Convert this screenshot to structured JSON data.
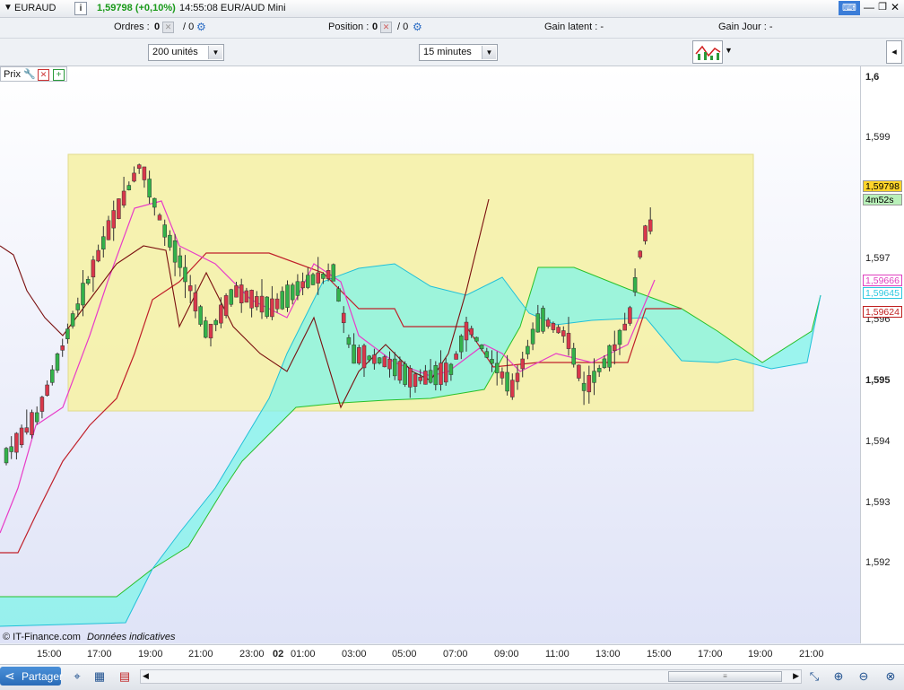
{
  "window": {
    "symbol": "EURAUD",
    "price_change": "1,59798 (+0,10%)",
    "time_title": "14:55:08 EUR/AUD Mini"
  },
  "infobar": {
    "orders_label": "Ordres :",
    "orders_value": "0",
    "orders_sep": "/ 0",
    "position_label": "Position :",
    "position_value": "0",
    "position_sep": "/ 0",
    "gain_latent": "Gain latent :  -",
    "gain_jour": "Gain Jour :  -"
  },
  "controls": {
    "units_select": "200 unités",
    "timeframe_select": "15 minutes"
  },
  "chart_header": {
    "label": "Prix"
  },
  "copyright": "© IT-Finance.com",
  "disclaimer": "Données indicatives",
  "price_axis": [
    {
      "label": "1,6",
      "bold": true
    },
    {
      "label": "1,599"
    },
    {
      "label": "1,597"
    },
    {
      "label": "1,596"
    },
    {
      "label": "1,595",
      "bold": true
    },
    {
      "label": "1,594"
    },
    {
      "label": "1,593"
    },
    {
      "label": "1,592"
    }
  ],
  "price_tags": [
    {
      "text": "1,59798",
      "bg": "#ffd42a",
      "fg": "#000"
    },
    {
      "text": "4m52s",
      "bg": "#b9f0b9",
      "fg": "#000"
    },
    {
      "text": "1,59666",
      "bg": "#ffffff",
      "fg": "#e040c0"
    },
    {
      "text": "1,59645",
      "bg": "#ffffff",
      "fg": "#2ec8e0"
    },
    {
      "text": "1,59624",
      "bg": "#ffffff",
      "fg": "#c02020"
    }
  ],
  "time_axis": [
    "15:00",
    "17:00",
    "19:00",
    "21:00",
    "23:00",
    "02",
    "01:00",
    "03:00",
    "05:00",
    "07:00",
    "09:00",
    "11:00",
    "13:00",
    "15:00",
    "17:00",
    "19:00",
    "21:00"
  ],
  "bottom": {
    "share_label": "Partager"
  },
  "colors": {
    "up_candle": "#33b24a",
    "down_candle": "#d9374b",
    "tenkan": "#c0202a",
    "kijun": "#e83cc8",
    "chikou": "#7a0f0f",
    "cloud_bull": "#66ee66",
    "cloud_bear": "#7ff4ea",
    "highlight_box": "#f6f2a8"
  }
}
